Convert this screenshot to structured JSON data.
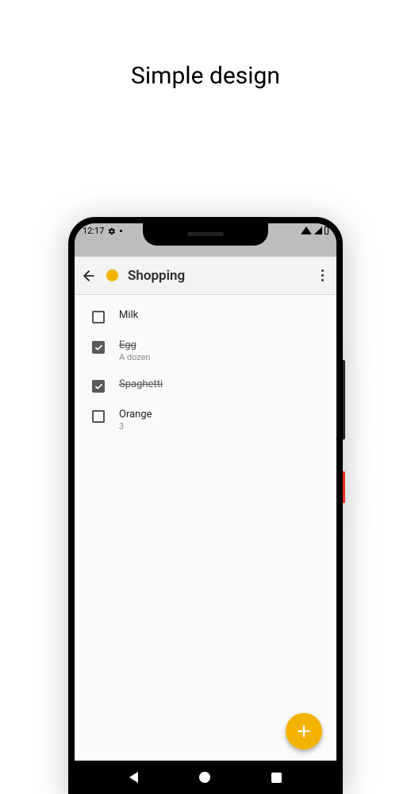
{
  "page_heading": "Simple design",
  "statusbar": {
    "time": "12:17"
  },
  "appbar": {
    "title": "Shopping",
    "accent_color": "#f5b301"
  },
  "items": [
    {
      "title": "Milk",
      "sub": "",
      "checked": false
    },
    {
      "title": "Egg",
      "sub": "A dozen",
      "checked": true
    },
    {
      "title": "Spaghetti",
      "sub": "",
      "checked": true
    },
    {
      "title": "Orange",
      "sub": "3",
      "checked": false
    }
  ],
  "fab": {
    "icon": "plus"
  }
}
